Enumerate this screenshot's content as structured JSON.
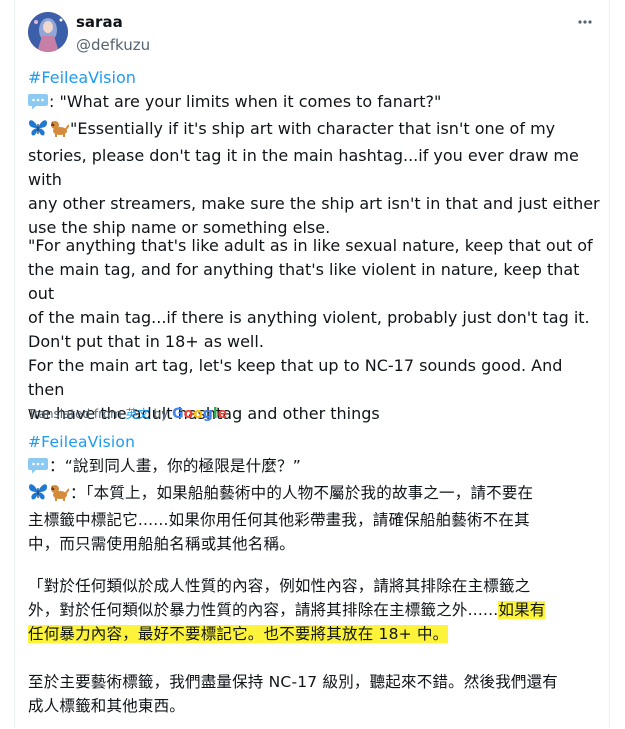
{
  "author": {
    "name": "saraa",
    "handle": "@defkuzu"
  },
  "menu_icon": "more-horizontal-icon",
  "post": {
    "hashtag": "#FeileaVision",
    "q_prefix": ": ",
    "q_text": "\"What are your limits when it comes to fanart?\"",
    "a1": "\"Essentially if it's ship art with character that isn't one of my",
    "a2": "stories, please don't tag it in the main hashtag...if you ever draw me with",
    "a3": "any other streamers, make sure the ship art isn't in that and just either",
    "a4": "use the ship name or something else.",
    "b1": "\"For anything that's like adult as in like sexual nature, keep that out of",
    "b2": "the main tag, and for anything that's like violent in nature, keep that out",
    "b3": "of the main tag...if there is anything violent, probably just don't tag it.",
    "b4": "Don't put that in 18+ as well.",
    "c1": "For the main art tag, let's keep that up to NC-17 sounds good. And then",
    "c2": "we have the adult hashtag and other things"
  },
  "translation": {
    "label": "Translated from",
    "source_lang": "英文",
    "by": "by",
    "provider": "Google",
    "hashtag": "#FeileaVision",
    "q_prefix": "：",
    "q_text": "“說到同人畫，你的極限是什麼？”",
    "a1": "：「本質上，如果船舶藝術中的人物不屬於我的故事之一，請不要在",
    "a2": "主標籤中標記它......如果你用任何其他彩帶畫我，請確保船舶藝術不在其",
    "a3": "中，而只需使用船舶名稱或其他名稱。",
    "b1": "「對於任何類似於成人性質的內容，例如性內容，請將其排除在主標籤之",
    "b2_plain": "外，對於任何類似於暴力性質的內容，請將其排除在主標籤之外......",
    "b2_hl": "如果有",
    "b3_hl": "任何暴力內容，最好不要標記它。也不要將其放在 18+ 中。",
    "c1": "至於主要藝術標籤，我們盡量保持 NC-17 級別，聽起來不錯。然後我們還有",
    "c2": "成人標籤和其他東西。"
  },
  "icons": {
    "speech": "speech-bubble-emoji",
    "butterfly": "butterfly-emoji",
    "dog": "dog-emoji"
  },
  "colors": {
    "hashtag": "#1d9bf0",
    "highlight": "#fdf33a",
    "secondary": "#536471"
  }
}
